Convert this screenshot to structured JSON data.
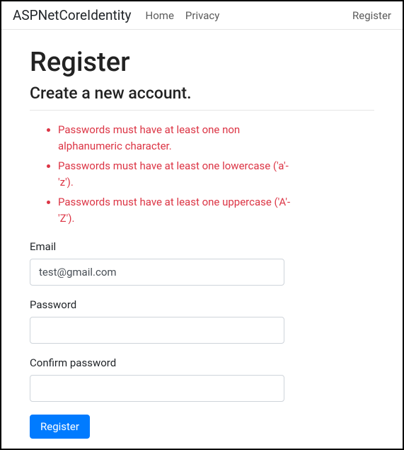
{
  "navbar": {
    "brand": "ASPNetCoreIdentity",
    "links": {
      "home": "Home",
      "privacy": "Privacy",
      "register": "Register"
    }
  },
  "page": {
    "title": "Register",
    "subtitle": "Create a new account."
  },
  "validation": {
    "errors": [
      "Passwords must have at least one non alphanumeric character.",
      "Passwords must have at least one lowercase ('a'-'z').",
      "Passwords must have at least one uppercase ('A'-'Z')."
    ]
  },
  "form": {
    "email": {
      "label": "Email",
      "value": "test@gmail.com"
    },
    "password": {
      "label": "Password",
      "value": ""
    },
    "confirmPassword": {
      "label": "Confirm password",
      "value": ""
    },
    "submit": "Register"
  }
}
